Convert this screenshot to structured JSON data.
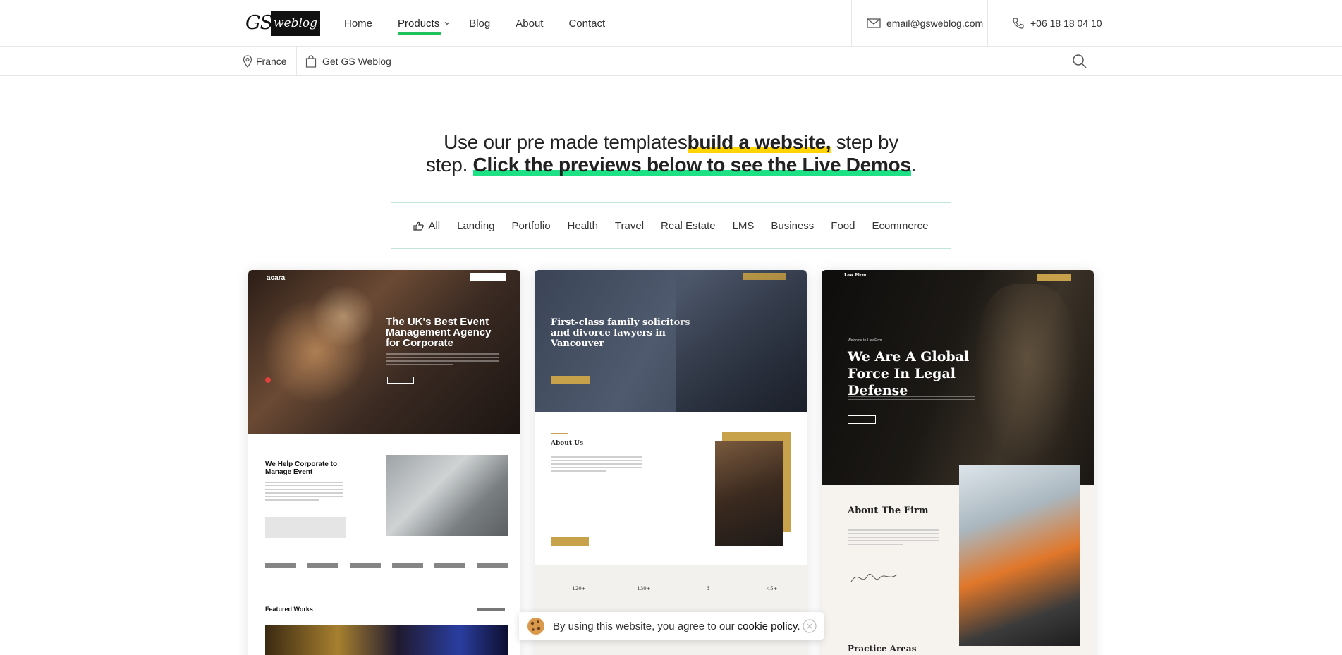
{
  "brand": {
    "logo_left": "GS",
    "logo_right": "weblog"
  },
  "nav": {
    "items": [
      {
        "label": "Home"
      },
      {
        "label": "Products"
      },
      {
        "label": "Blog"
      },
      {
        "label": "About"
      },
      {
        "label": "Contact"
      }
    ],
    "active": "Products"
  },
  "contact": {
    "email": "email@gsweblog.com",
    "phone": "+06 18 18 04 10"
  },
  "subbar": {
    "location": "France",
    "get_label": "Get GS Weblog"
  },
  "hero": {
    "part1": "Use our pre made templates",
    "highlight1": "build a website,",
    "part2": " step by step. ",
    "highlight2": "Click the previews below to see the Live Demos",
    "part3": "."
  },
  "filters": [
    "All",
    "Landing",
    "Portfolio",
    "Health",
    "Travel",
    "Real Estate",
    "LMS",
    "Business",
    "Food",
    "Ecommerce"
  ],
  "cards": {
    "card1": {
      "logo": "acara",
      "title": "The UK's Best Event Management Agency for Corporate",
      "about_title": "We Help Corporate to Manage Event",
      "featured": "Featured Works"
    },
    "card2": {
      "title": "First-class family solicitors and divorce lawyers in Vancouver",
      "about": "About Us",
      "stats": [
        "120+",
        "130+",
        "3",
        "45+"
      ]
    },
    "card3": {
      "logo": "Law Firm",
      "welcome": "Welcome to Law Firm",
      "title": "We Are A Global Force In Legal Defense",
      "about": "About The Firm",
      "practice": "Practice Areas"
    }
  },
  "cookie": {
    "text": "By using this website, you agree to our",
    "link": "cookie policy."
  },
  "colors": {
    "accent_green": "#1fc35a",
    "highlight_yellow": "#ffd400",
    "highlight_green": "#1ee085",
    "gold": "#c8a24a"
  }
}
